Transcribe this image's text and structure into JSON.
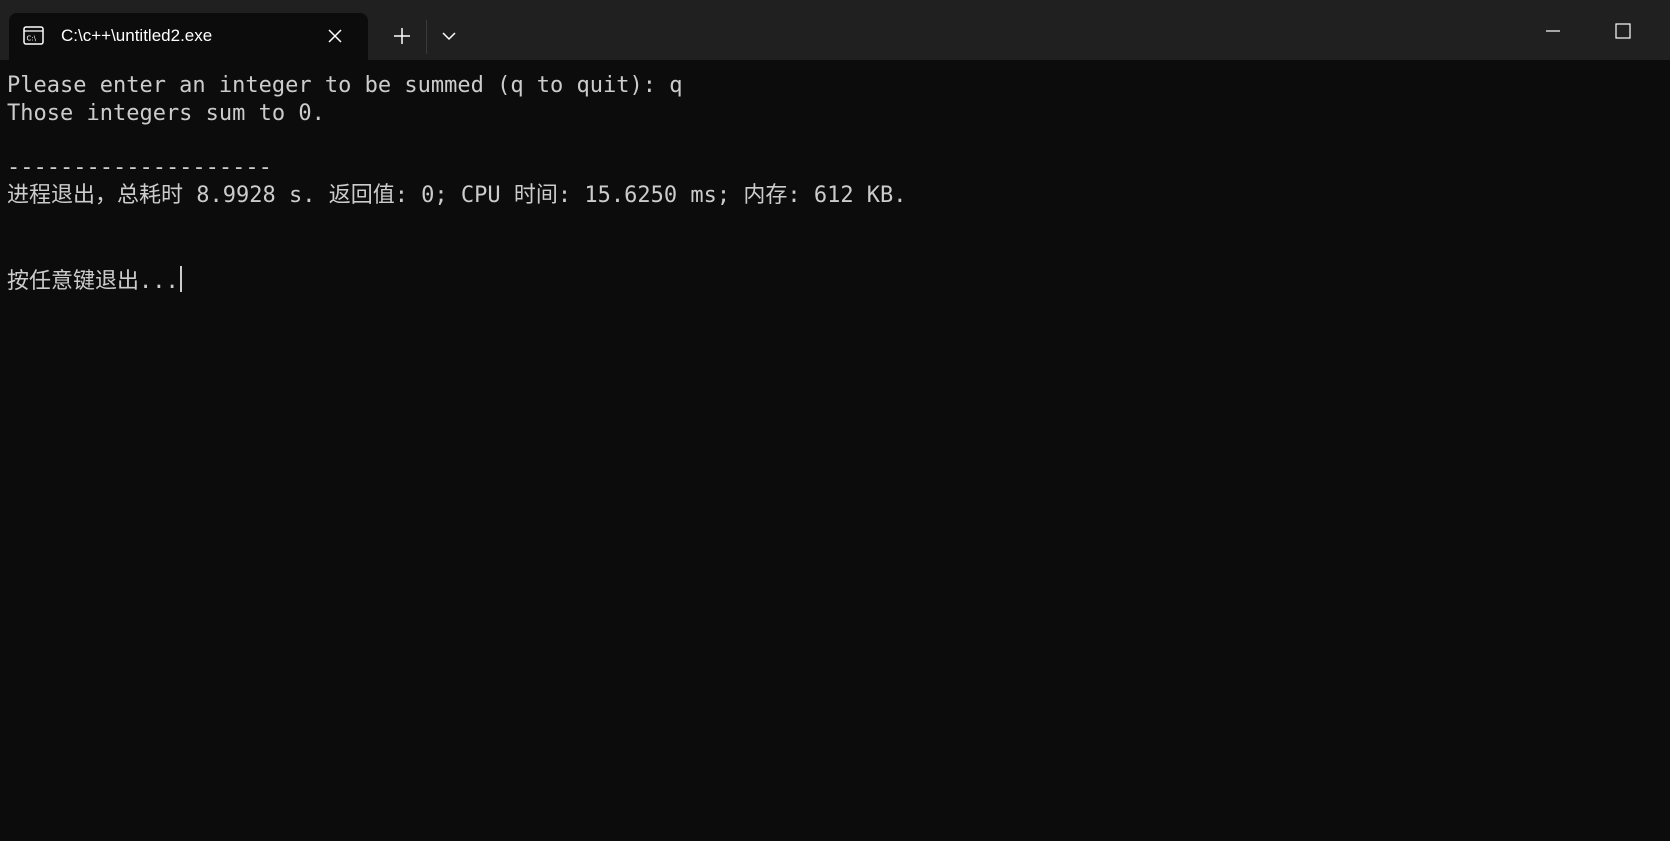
{
  "tab": {
    "title": "C:\\c++\\untitled2.exe",
    "icon": "terminal-icon"
  },
  "toolbar": {
    "new_tab_icon": "plus-icon",
    "dropdown_icon": "chevron-down-icon"
  },
  "window_controls": {
    "minimize_icon": "minimize-icon",
    "maximize_icon": "maximize-icon"
  },
  "console": {
    "lines": [
      "Please enter an integer to be summed (q to quit): q",
      "Those integers sum to 0.",
      "--------------------",
      "进程退出，总耗时 8.9928 s. 返回值: 0; CPU 时间: 15.6250 ms; 内存: 612 KB.",
      "按任意键退出..."
    ]
  },
  "colors": {
    "background": "#0c0c0c",
    "titlebar": "#202020",
    "text": "#cccccc",
    "tab_text": "#ffffff"
  }
}
